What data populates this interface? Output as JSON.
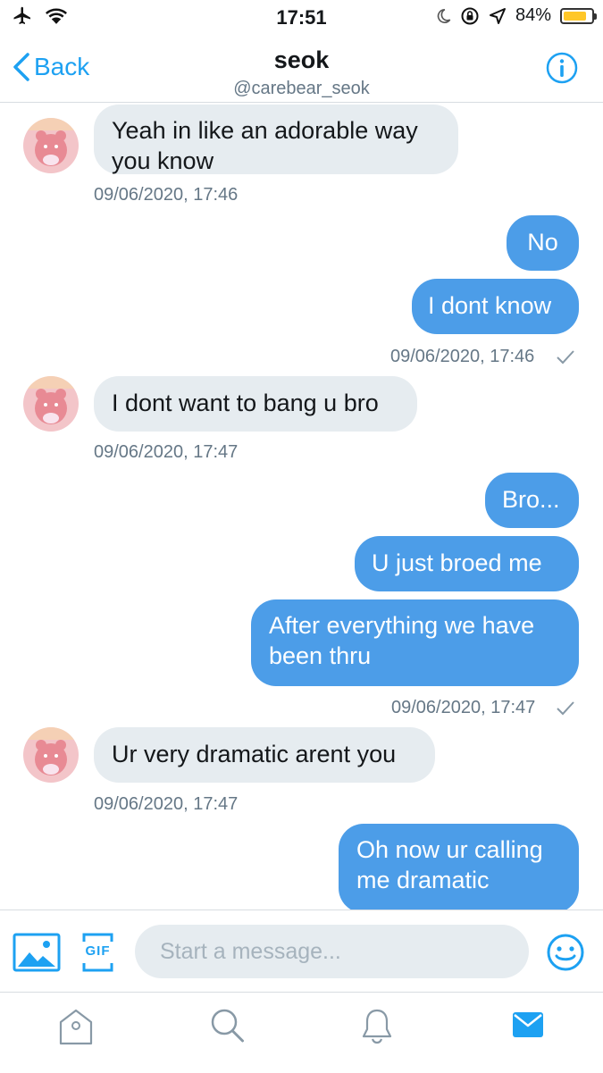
{
  "status_bar": {
    "time": "17:51",
    "battery_text": "84%",
    "battery_level": 0.84,
    "icons": [
      "airplane-icon",
      "wifi-icon",
      "moon-icon",
      "orientation-lock-icon",
      "location-icon",
      "battery-icon"
    ]
  },
  "header": {
    "back_label": "Back",
    "name": "seok",
    "handle": "@carebear_seok",
    "info_icon": "info-icon"
  },
  "messages": [
    {
      "side": "in",
      "lines": [
        "Yeah in like an adorable way",
        "you know"
      ],
      "time": "09/06/2020, 17:46"
    },
    {
      "side": "out",
      "text": "No"
    },
    {
      "side": "out",
      "text": "I dont know",
      "time": "09/06/2020, 17:46"
    },
    {
      "side": "in",
      "text": "I dont want to bang u bro",
      "time": "09/06/2020, 17:47"
    },
    {
      "side": "out",
      "text": "Bro..."
    },
    {
      "side": "out",
      "text": "U just broed me"
    },
    {
      "side": "out",
      "lines": [
        "After everything we have",
        "been thru"
      ],
      "time": "09/06/2020, 17:47"
    },
    {
      "side": "in",
      "text": "Ur very dramatic arent you",
      "time": "09/06/2020, 17:47"
    },
    {
      "side": "out",
      "lines": [
        "Oh now ur calling",
        "me dramatic"
      ]
    }
  ],
  "composer": {
    "placeholder": "Start a message...",
    "gif_label": "GIF"
  },
  "tabbar": {
    "tabs": [
      "home-icon",
      "search-icon",
      "notifications-icon",
      "messages-icon"
    ],
    "active": "messages-icon"
  },
  "colors": {
    "accent": "#1da1f2",
    "outgoing_bubble": "#4c9de8",
    "incoming_bubble": "#e6ecf0",
    "timestamp": "#657786"
  }
}
